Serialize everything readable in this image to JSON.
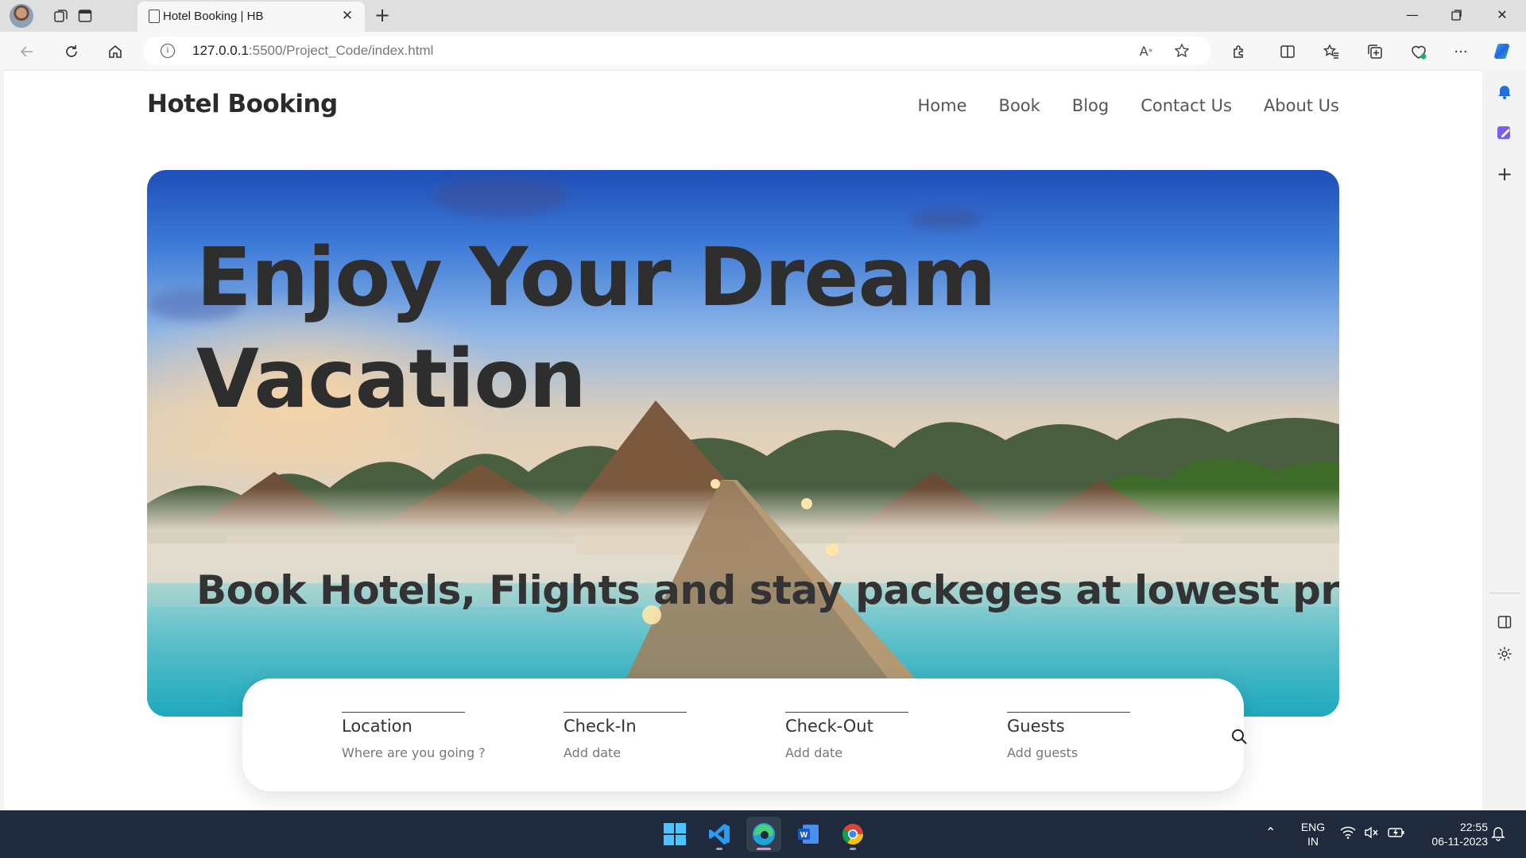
{
  "browser": {
    "tab_title": "Hotel Booking | HB",
    "url_host": "127.0.0.1",
    "url_rest": ":5500/Project_Code/index.html"
  },
  "site": {
    "logo": "Hotel Booking",
    "nav": [
      "Home",
      "Book",
      "Blog",
      "Contact Us",
      "About Us"
    ],
    "hero": {
      "title": "Enjoy Your Dream Vacation",
      "subtitle": "Book Hotels, Flights and stay packeges at lowest price."
    },
    "search": {
      "fields": [
        {
          "label": "Location",
          "value": "Where are you going ?"
        },
        {
          "label": "Check-In",
          "value": "Add date"
        },
        {
          "label": "Check-Out",
          "value": "Add date"
        },
        {
          "label": "Guests",
          "value": "Add guests"
        }
      ]
    }
  },
  "taskbar": {
    "apps": [
      "windows-start",
      "vscode",
      "edge",
      "word",
      "chrome"
    ],
    "language": "ENG",
    "region": "IN",
    "time": "22:55",
    "date": "06-11-2023"
  },
  "colors": {
    "accent_blue": "#0a6cd8",
    "taskbar": "#1f2b3d",
    "text_dark": "#2e2e2e"
  }
}
